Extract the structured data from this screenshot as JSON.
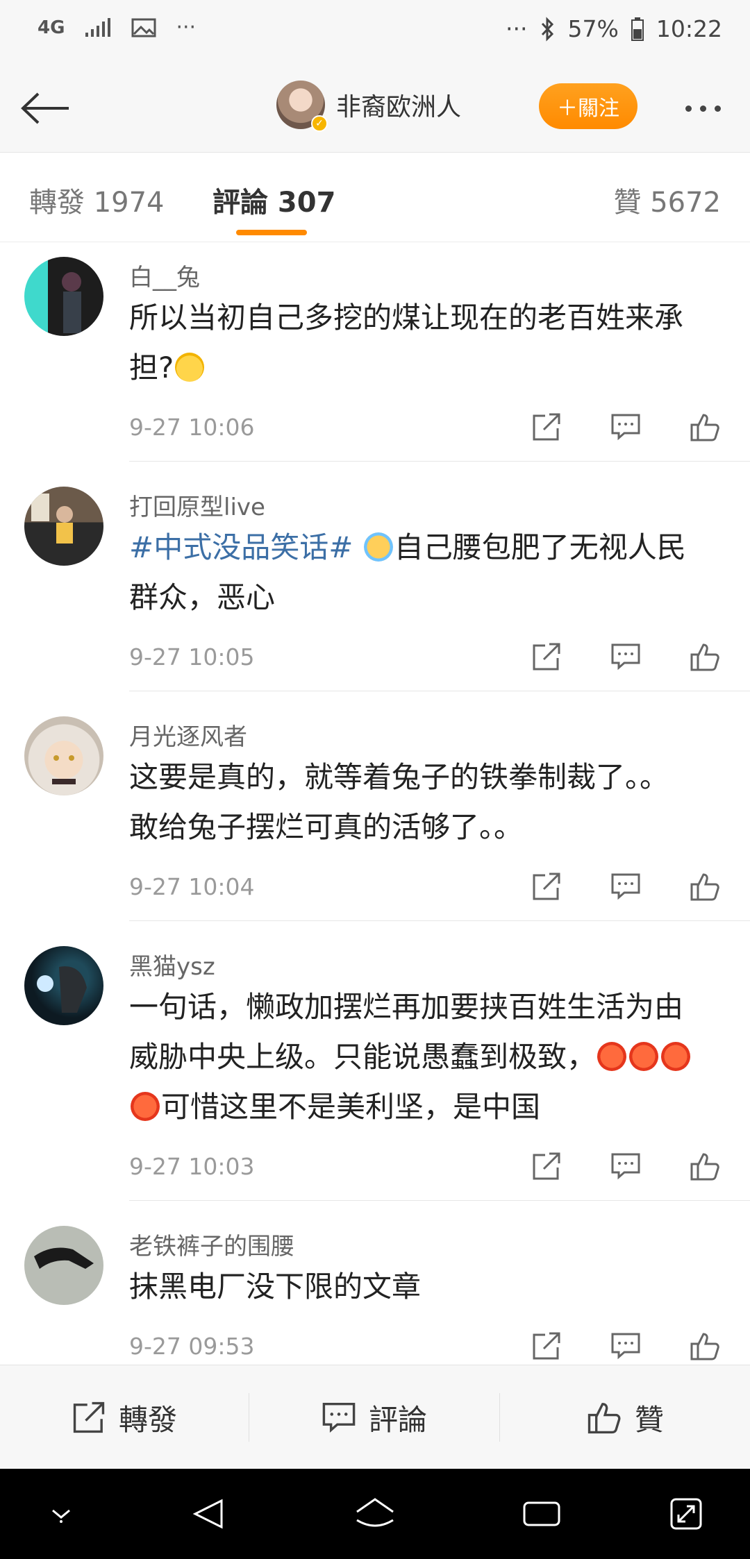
{
  "status": {
    "network": "4G",
    "battery": "57%",
    "time": "10:22",
    "overflow": "···"
  },
  "header": {
    "user_name": "非裔欧洲人",
    "follow_label": "＋關注"
  },
  "tabs": [
    {
      "label": "轉發 1974"
    },
    {
      "label": "評論 307"
    },
    {
      "label": "贊 5672"
    }
  ],
  "comments": [
    {
      "name": "白__兔",
      "text_lines": [
        "所以当初自己多挖的煤让现在的老百姓来承",
        "担?"
      ],
      "emoji": "thinking-emoji",
      "time": "9-27 10:06"
    },
    {
      "name": "打回原型live",
      "hashtag": "#中式没品笑话#",
      "text_lines": [
        "自己腰包肥了无视人民",
        "群众，恶心"
      ],
      "emoji": "crying-emoji",
      "time": "9-27 10:05"
    },
    {
      "name": "月光逐风者",
      "text_lines": [
        "这要是真的，就等着兔子的铁拳制裁了。。",
        "敢给兔子摆烂可真的活够了。。"
      ],
      "time": "9-27 10:04"
    },
    {
      "name": "黑猫ysz",
      "text_lines": [
        "一句话，懒政加摆烂再加要挟百姓生活为由",
        "威胁中央上级。只能说愚蠢到极致，",
        "可惜这里不是美利坚，是中国"
      ],
      "emoji": "angry-emoji",
      "time": "9-27 10:03"
    },
    {
      "name": "老铁裤子的围腰",
      "text_lines": [
        "抹黑电厂没下限的文章"
      ],
      "time": "9-27 09:53"
    }
  ],
  "bottom_bar": {
    "repost_label": "轉發",
    "comment_label": "評論",
    "like_label": "贊"
  },
  "colors": {
    "accent": "#ff8a00",
    "hashtag": "#3c6fa6",
    "verified": "#f7b500"
  }
}
